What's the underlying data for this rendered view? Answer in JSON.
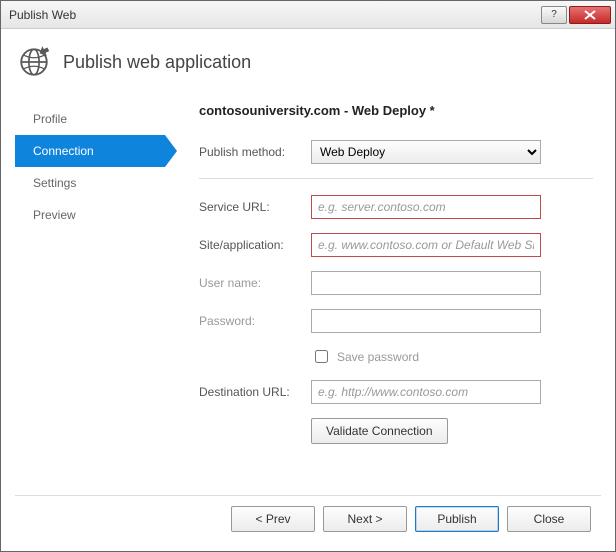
{
  "window": {
    "title": "Publish Web"
  },
  "header": {
    "title": "Publish web application"
  },
  "sidebar": {
    "items": [
      {
        "label": "Profile"
      },
      {
        "label": "Connection"
      },
      {
        "label": "Settings"
      },
      {
        "label": "Preview"
      }
    ],
    "active_index": 1
  },
  "content": {
    "profile_title": "contosouniversity.com - Web Deploy *",
    "labels": {
      "publish_method": "Publish method:",
      "service_url": "Service URL:",
      "site_application": "Site/application:",
      "user_name": "User name:",
      "password": "Password:",
      "save_password": "Save password",
      "destination_url": "Destination URL:"
    },
    "publish_method": {
      "selected": "Web Deploy"
    },
    "fields": {
      "service_url": {
        "value": "",
        "placeholder": "e.g. server.contoso.com"
      },
      "site_application": {
        "value": "",
        "placeholder": "e.g. www.contoso.com or Default Web Site/MyApp"
      },
      "user_name": {
        "value": "",
        "placeholder": ""
      },
      "password": {
        "value": "",
        "placeholder": ""
      },
      "save_password": {
        "checked": false
      },
      "destination_url": {
        "value": "",
        "placeholder": "e.g. http://www.contoso.com"
      }
    },
    "buttons": {
      "validate": "Validate Connection"
    }
  },
  "footer": {
    "prev": "< Prev",
    "next": "Next >",
    "publish": "Publish",
    "close": "Close"
  }
}
